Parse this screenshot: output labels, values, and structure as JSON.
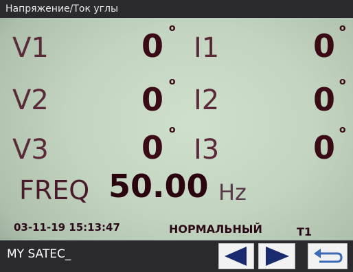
{
  "header": {
    "title": "Напряжение/Ток углы"
  },
  "measurements": {
    "v1": {
      "label": "V1",
      "value": "0",
      "unit": "o"
    },
    "v2": {
      "label": "V2",
      "value": "0",
      "unit": "o"
    },
    "v3": {
      "label": "V3",
      "value": "0",
      "unit": "o"
    },
    "i1": {
      "label": "I1",
      "value": "0",
      "unit": "o"
    },
    "i2": {
      "label": "I2",
      "value": "0",
      "unit": "o"
    },
    "i3": {
      "label": "I3",
      "value": "0",
      "unit": "o"
    }
  },
  "frequency": {
    "label": "FREQ",
    "value": "50.00",
    "unit": "Hz"
  },
  "status_line": {
    "datetime": "03-11-19 15:13:47",
    "mode": "НОРМАЛЬНЫЙ",
    "tariff": "T1"
  },
  "footer": {
    "device_name": "MY SATEC_",
    "buttons": [
      {
        "name": "prev",
        "icon": "arrow-left-icon"
      },
      {
        "name": "next",
        "icon": "arrow-right-icon"
      },
      {
        "name": "return",
        "icon": "return-icon"
      }
    ]
  },
  "colors": {
    "screen_bg": "#c3d5c1",
    "bar_bg": "#2a2a2e",
    "value_text": "#3a0a16",
    "label_text": "#5a2a3a",
    "button_bg": "#f2f2f2",
    "arrow": "#1a2a6e",
    "return_arrow": "#3a6ab8"
  }
}
